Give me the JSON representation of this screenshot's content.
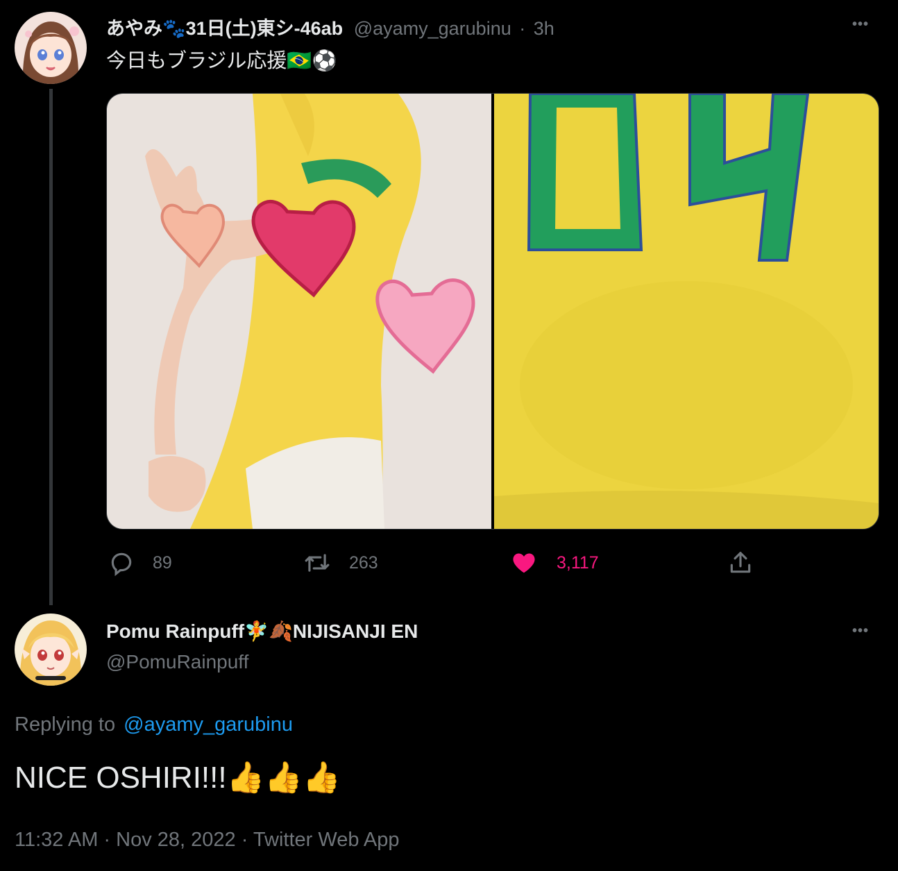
{
  "tweet1": {
    "display_name": "あやみ🐾31日(土)東シ-46ab",
    "handle": "@ayamy_garubinu",
    "separator": "·",
    "time": "3h",
    "text": "今日もブラジル応援🇧🇷⚽",
    "more_icon": "more-dots-icon",
    "actions": {
      "reply_count": "89",
      "retweet_count": "263",
      "like_count": "3,117",
      "reply_icon": "reply-bubble-icon",
      "retweet_icon": "retweet-icon",
      "like_icon": "heart-filled-icon",
      "share_icon": "share-upload-icon"
    },
    "like_color": "#f91880"
  },
  "tweet2": {
    "display_name": "Pomu Rainpuff🧚🍂NIJISANJI EN",
    "handle": "@PomuRainpuff",
    "replying_prefix": "Replying to",
    "replying_handle": "@ayamy_garubinu",
    "text": "NICE OSHIRI!!!👍👍👍",
    "timestamp": "11:32 AM · Nov 28, 2022 · Twitter Web App",
    "more_icon": "more-dots-icon"
  },
  "colors": {
    "background": "#000000",
    "primary_text": "#e7e9ea",
    "secondary_text": "#71767b",
    "link": "#1d9bf0",
    "like": "#f91880"
  }
}
